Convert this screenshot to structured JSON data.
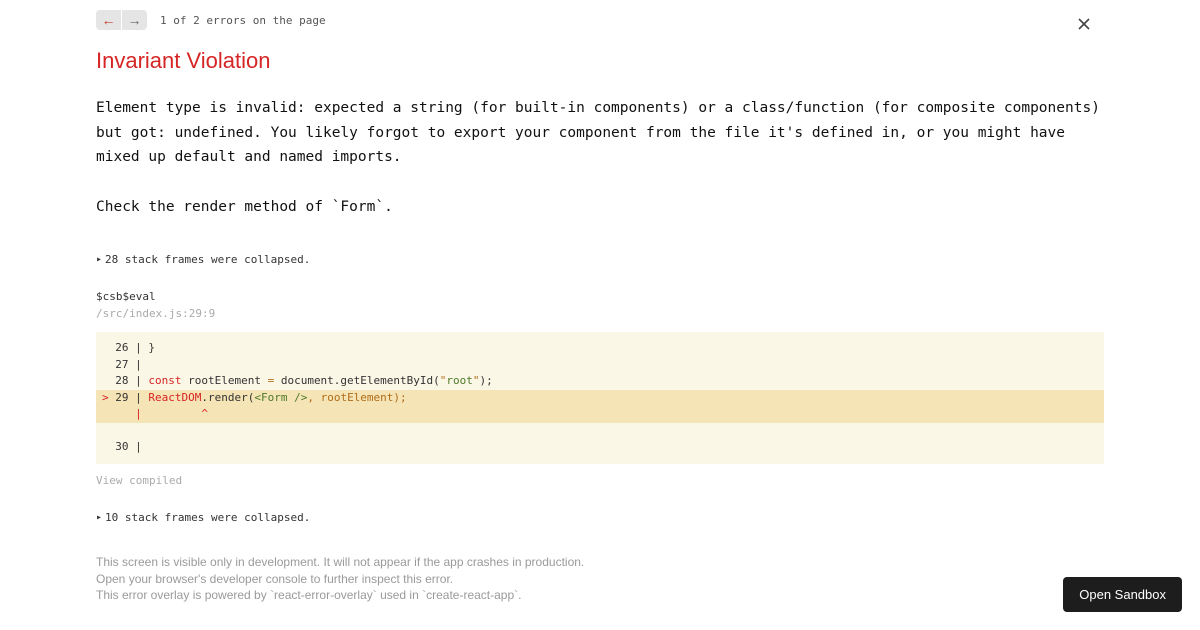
{
  "nav": {
    "counter": "1 of 2 errors on the page"
  },
  "error": {
    "title": "Invariant Violation",
    "message": "Element type is invalid: expected a string (for built-in components) or a class/function (for composite components) but got: undefined. You likely forgot to export your component from the file it's defined in, or you might have mixed up default and named imports.\n\nCheck the render method of `Form`."
  },
  "collapse1": "28 stack frames were collapsed.",
  "frame": {
    "fn": "$csb$eval",
    "loc": "/src/index.js:29:9"
  },
  "code": {
    "l26": "  26 | }",
    "l27": "  27 | ",
    "l28_pre": "  28 | ",
    "l28_kw": "const",
    "l28_mid": " rootElement ",
    "l28_eq": "=",
    "l28_after": " document.getElementById(",
    "l28_q1": "\"",
    "l28_str": "root",
    "l28_q2": "\"",
    "l28_end": ");",
    "l29_mark": ">",
    "l29_pre": " 29 | ",
    "l29_dom": "ReactDOM",
    "l29_render": ".render(",
    "l29_jsx": "<Form />",
    "l29_end": ", rootElement);",
    "caret": "     |         ^",
    "l30": "  30 | "
  },
  "view_compiled": "View compiled",
  "collapse2": "10 stack frames were collapsed.",
  "footer": {
    "l1": "This screen is visible only in development. It will not appear if the app crashes in production.",
    "l2": "Open your browser's developer console to further inspect this error.",
    "l3": "This error overlay is powered by `react-error-overlay` used in `create-react-app`."
  },
  "sandbox_btn": "Open Sandbox"
}
